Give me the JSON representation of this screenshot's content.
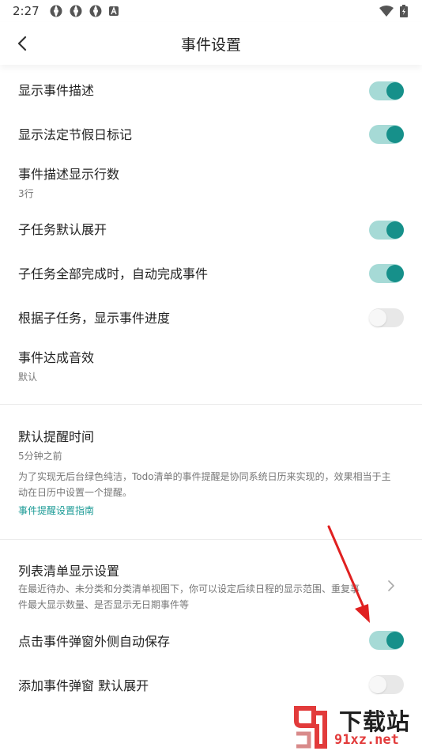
{
  "status_bar": {
    "time": "2:27"
  },
  "header": {
    "title": "事件设置"
  },
  "settings": {
    "show_desc": {
      "label": "显示事件描述",
      "on": true
    },
    "show_holiday": {
      "label": "显示法定节假日标记",
      "on": true
    },
    "desc_lines": {
      "label": "事件描述显示行数",
      "value": "3行"
    },
    "subtask_expand": {
      "label": "子任务默认展开",
      "on": true
    },
    "subtask_autocomplete": {
      "label": "子任务全部完成时，自动完成事件",
      "on": true
    },
    "progress_by_subtask": {
      "label": "根据子任务，显示事件进度",
      "on": false
    },
    "done_sound": {
      "label": "事件达成音效",
      "value": "默认"
    },
    "reminder": {
      "label": "默认提醒时间",
      "value": "5分钟之前",
      "note": "为了实现无后台绿色纯洁，Todo清单的事件提醒是协同系统日历来实现的，效果相当于主动在日历中设置一个提醒。",
      "link": "事件提醒设置指南"
    },
    "list_display": {
      "label": "列表清单显示设置",
      "desc": "在最近待办、未分类和分类清单视图下，你可以设定后续日程的显示范围、重复事件最大显示数量、是否显示无日期事件等"
    },
    "popup_autosave": {
      "label": "点击事件弹窗外侧自动保存",
      "on": true
    },
    "popup_expand": {
      "label": "添加事件弹窗 默认展开",
      "on": false
    }
  },
  "watermark": {
    "brand": "下载站",
    "url": "91xz.net"
  },
  "colors": {
    "accent": "#16908a",
    "track_on": "#a6dad6",
    "annotation": "#e02020"
  }
}
